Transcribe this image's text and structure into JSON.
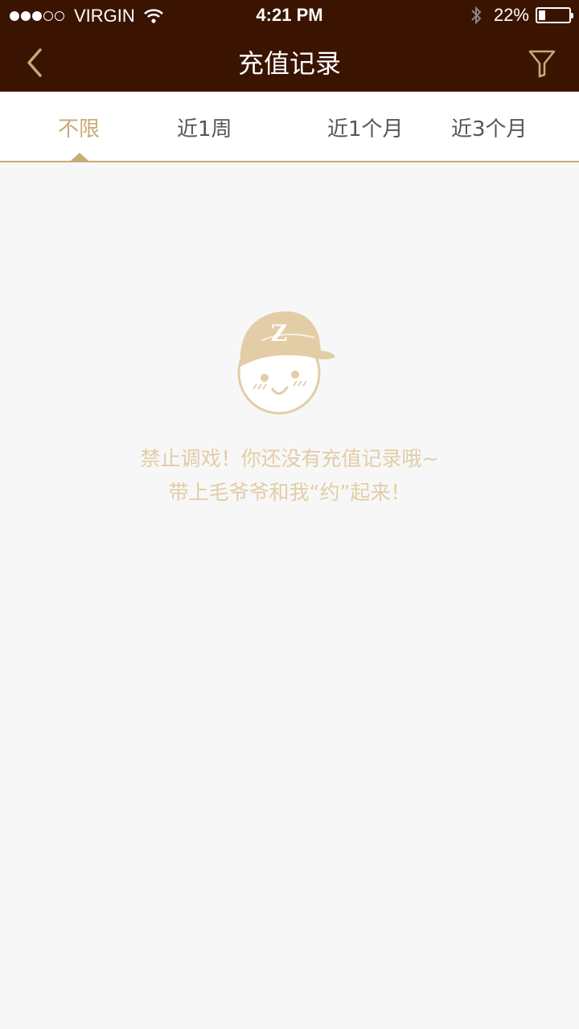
{
  "status_bar": {
    "carrier": "VIRGIN",
    "time": "4:21 PM",
    "battery": "22%",
    "battery_level": 0.22
  },
  "nav": {
    "title": "充值记录",
    "back_icon": "chevron-left-icon",
    "filter_icon": "filter-icon"
  },
  "tabs": [
    {
      "label": "不限",
      "active": true
    },
    {
      "label": "近1周",
      "active": false
    },
    {
      "label": "近1个月",
      "active": false
    },
    {
      "label": "近3个月",
      "active": false
    }
  ],
  "empty_state": {
    "mascot_letter": "Z",
    "line1": "禁止调戏！你还没有充值记录哦~",
    "line2": "带上毛爷爷和我“约”起来！"
  },
  "colors": {
    "header_bg": "#3a1400",
    "accent": "#c9a978",
    "empty_text": "#e2cda6",
    "page_bg": "#f7f7f7"
  }
}
